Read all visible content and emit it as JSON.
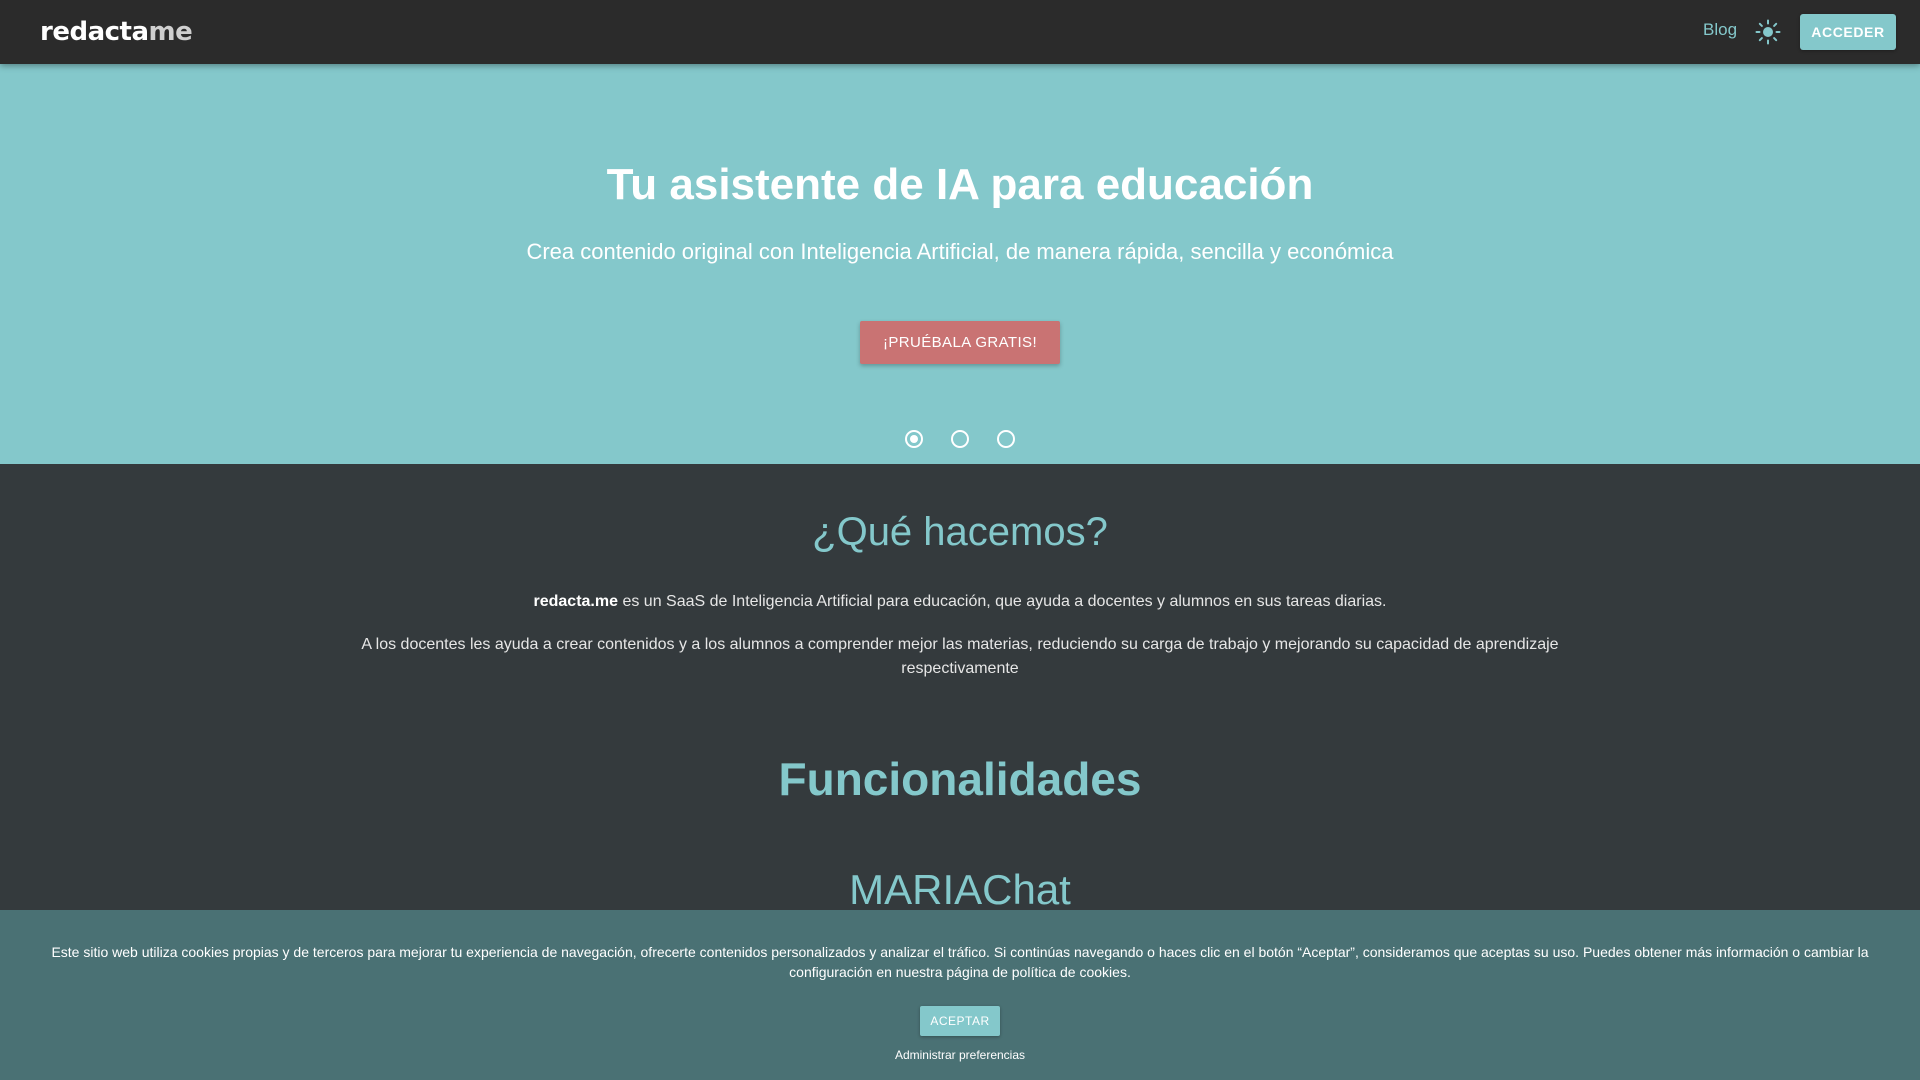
{
  "header": {
    "logo_text": "redacta",
    "logo_suffix": "me",
    "blog_label": "Blog",
    "theme_icon": "sun-icon",
    "login_label": "ACCEDER"
  },
  "hero": {
    "title": "Tu asistente de IA para educación",
    "subtitle": "Crea contenido original con Inteligencia Artificial, de manera rápida, sencilla y económica",
    "cta_label": "¡PRUÉBALA GRATIS!",
    "slides_count": 3,
    "active_slide": 1
  },
  "what": {
    "title": "¿Qué hacemos?",
    "brand": "redacta.me",
    "p1_rest": " es un SaaS de Inteligencia Artificial para educación, que ayuda a docentes y alumnos en sus tareas diarias.",
    "p2": "A los docentes les ayuda a crear contenidos y a los alumnos a comprender mejor las materias, reduciendo su carga de trabajo y mejorando su capacidad de aprendizaje respectivamente"
  },
  "features": {
    "title": "Funcionalidades",
    "first_feature": "MARIAChat"
  },
  "cookie": {
    "text": "Este sitio web utiliza cookies propias y de terceros para mejorar tu experiencia de navegación, ofrecerte contenidos personalizados y analizar el tráfico. Si continúas navegando o haces clic en el botón “Aceptar”, consideramos que aceptas su uso. Puedes obtener más información o cambiar la configuración en nuestra página de política de cookies.",
    "accept_label": "ACEPTAR",
    "manage_label": "Administrar preferencias"
  },
  "colors": {
    "accent": "#84c8cb",
    "cta": "#c97373",
    "header_bg": "#2b2b2b",
    "content_bg": "#343a3d",
    "cookie_bg": "#4a7174"
  }
}
